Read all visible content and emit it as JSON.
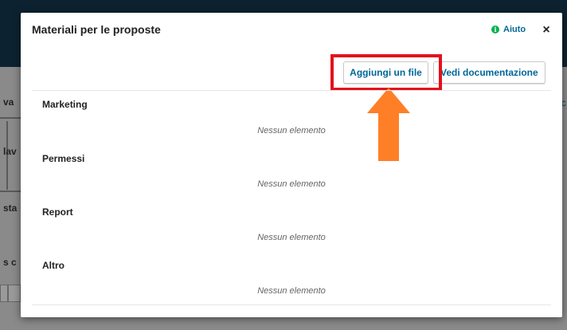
{
  "modal": {
    "title": "Materiali per le proposte",
    "help_label": "Aiuto",
    "close_symbol": "×"
  },
  "toolbar": {
    "add_file_label": "Aggiungi un file",
    "view_docs_label": "Vedi documentazione"
  },
  "categories": [
    {
      "title": "Marketing",
      "empty": "Nessun elemento"
    },
    {
      "title": "Permessi",
      "empty": "Nessun elemento"
    },
    {
      "title": "Report",
      "empty": "Nessun elemento"
    },
    {
      "title": "Altro",
      "empty": "Nessun elemento"
    }
  ],
  "background": {
    "fragments": [
      "va",
      "lav",
      "sta",
      "s c"
    ],
    "right_fragment": "lc"
  },
  "colors": {
    "link": "#006798",
    "highlight": "#e3111c",
    "arrow": "#ff7f27",
    "help_icon": "#00b24e"
  },
  "icons": {
    "help": "info-icon",
    "close": "close-icon",
    "annotation": "arrow-up-icon"
  }
}
